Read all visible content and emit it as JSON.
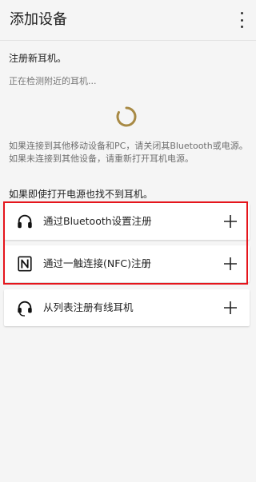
{
  "appbar": {
    "title": "添加设备",
    "overflow_icon": "more-vert-icon"
  },
  "content": {
    "heading": "注册新耳机。",
    "status": "正在检测附近的耳机...",
    "spinner_color": "#a88a45",
    "info": "如果连接到其他移动设备和PC，请关闭其Bluetooth或电源。如果未连接到其他设备，请重新打开耳机电源。",
    "section_label": "如果即使打开电源也找不到耳机。"
  },
  "options": [
    {
      "label": "通过Bluetooth设置注册",
      "icon": "headphones-icon",
      "action_icon": "plus-icon"
    },
    {
      "label": "通过一触连接(NFC)注册",
      "icon": "nfc-icon",
      "action_icon": "plus-icon"
    },
    {
      "label": "从列表注册有线耳机",
      "icon": "wired-headphones-icon",
      "action_icon": "plus-icon"
    }
  ],
  "colors": {
    "background": "#f5f5f5",
    "card": "#ffffff",
    "highlight_border": "#e5151c"
  }
}
